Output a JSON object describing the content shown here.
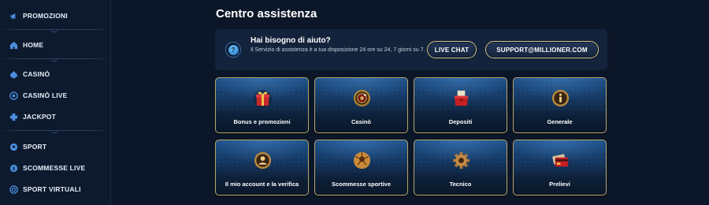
{
  "sidebar": {
    "items": [
      {
        "label": "PROMOZIONI",
        "icon": "megaphone-icon"
      },
      {
        "label": "HOME",
        "icon": "home-icon"
      },
      {
        "label": "CASINÒ",
        "icon": "spade-icon"
      },
      {
        "label": "CASINÒ LIVE",
        "icon": "roulette-icon"
      },
      {
        "label": "JACKPOT",
        "icon": "plus-badge-icon"
      },
      {
        "label": "SPORT",
        "icon": "soccer-ball-icon"
      },
      {
        "label": "SCOMMESSE LIVE",
        "icon": "coin-icon"
      },
      {
        "label": "SPORT VIRTUALI",
        "icon": "target-icon"
      }
    ]
  },
  "main": {
    "title": "Centro assistenza",
    "help": {
      "title": "Hai bisogno di aiuto?",
      "text": "Il Servizio di assistenza è a tua disposizione 24 ore su 24, 7 giorni su 7.",
      "icon": "question-icon",
      "chat_label": "LIVE CHAT",
      "email_label": "SUPPORT@MILLIONER.COM"
    },
    "cards": [
      {
        "label": "Bonus e promozioni",
        "icon": "gift-icon"
      },
      {
        "label": "Casinò",
        "icon": "roulette-wheel-icon"
      },
      {
        "label": "Depositi",
        "icon": "wallet-icon"
      },
      {
        "label": "Generale",
        "icon": "info-icon"
      },
      {
        "label": "Il mio account e la verifica",
        "icon": "account-icon"
      },
      {
        "label": "Scommesse sportive",
        "icon": "soccer-ball-icon"
      },
      {
        "label": "Tecnico",
        "icon": "gear-icon"
      },
      {
        "label": "Prelievi",
        "icon": "credit-card-icon"
      }
    ]
  },
  "colors": {
    "background": "#0b1628",
    "sidebar": "#0d1a2e",
    "accent_gold": "#d6c48a",
    "accent_blue": "#3d8fe0"
  }
}
